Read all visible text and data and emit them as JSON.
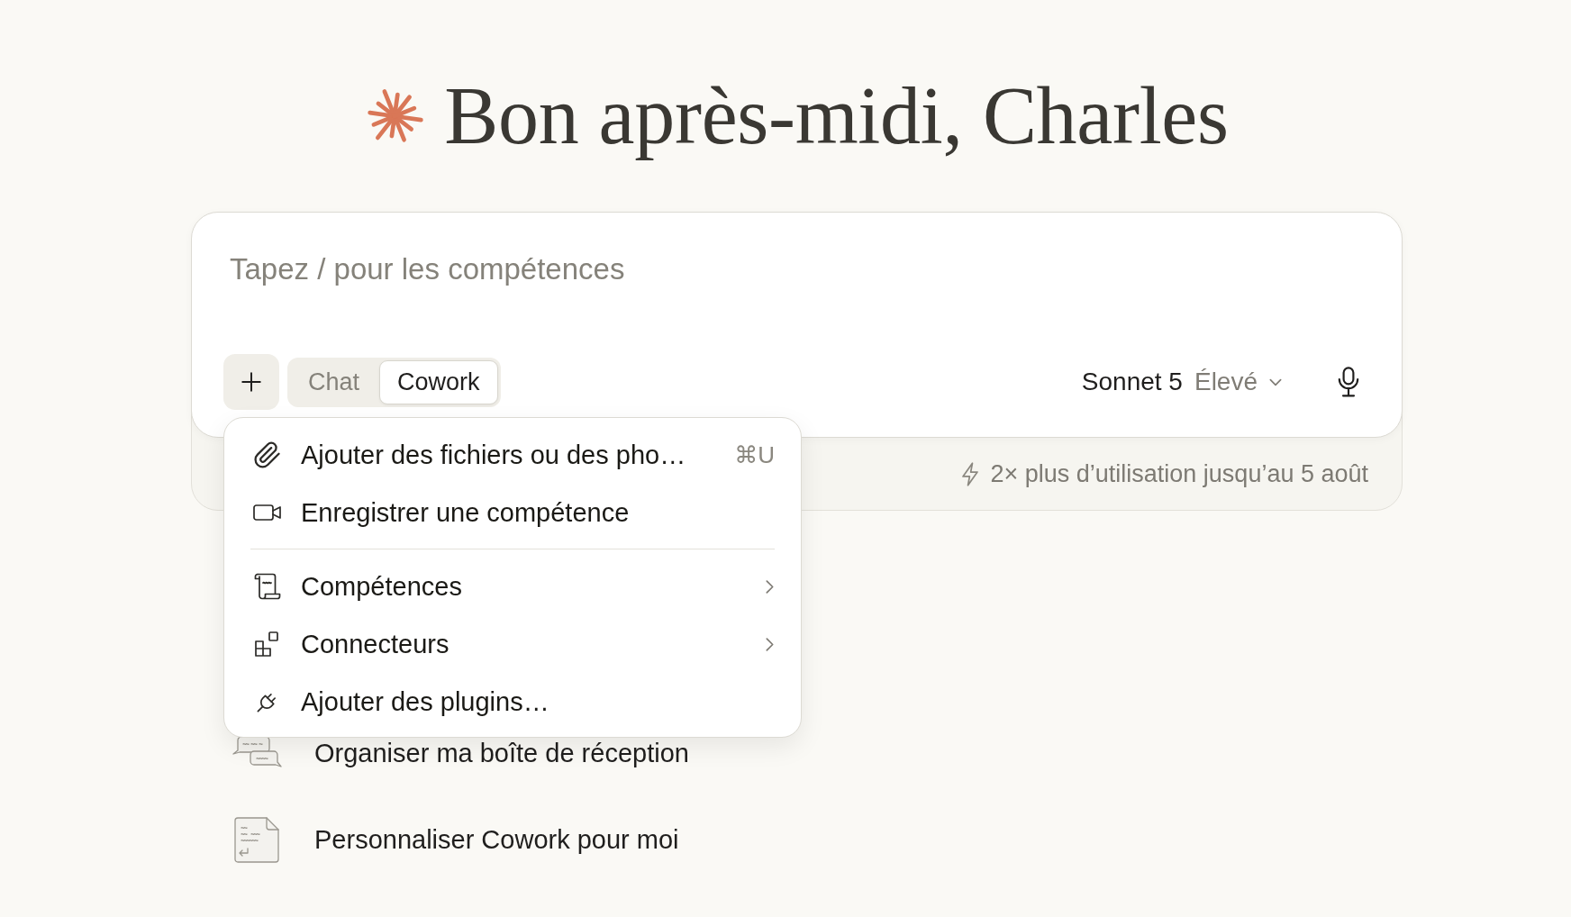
{
  "greeting": {
    "title": "Bon après-midi, Charles"
  },
  "composer": {
    "placeholder": "Tapez / pour les compétences",
    "modes": [
      {
        "label": "Chat",
        "selected": false
      },
      {
        "label": "Cowork",
        "selected": true
      }
    ],
    "model": {
      "name": "Sonnet 5",
      "effort": "Élevé"
    },
    "usage_notice": "2× plus d’utilisation jusqu’au 5 août"
  },
  "attach_menu": {
    "sections": [
      {
        "items": [
          {
            "label": "Ajouter des fichiers ou des pho…",
            "shortcut": "⌘U",
            "submenu": false
          },
          {
            "label": "Enregistrer une compétence",
            "submenu": false
          }
        ]
      },
      {
        "items": [
          {
            "label": "Compétences",
            "submenu": true
          },
          {
            "label": "Connecteurs",
            "submenu": true
          },
          {
            "label": "Ajouter des plugins…",
            "submenu": false
          }
        ]
      }
    ]
  },
  "suggestions": [
    {
      "label": "Organiser ma boîte de réception"
    },
    {
      "label": "Personnaliser Cowork pour moi"
    }
  ]
}
